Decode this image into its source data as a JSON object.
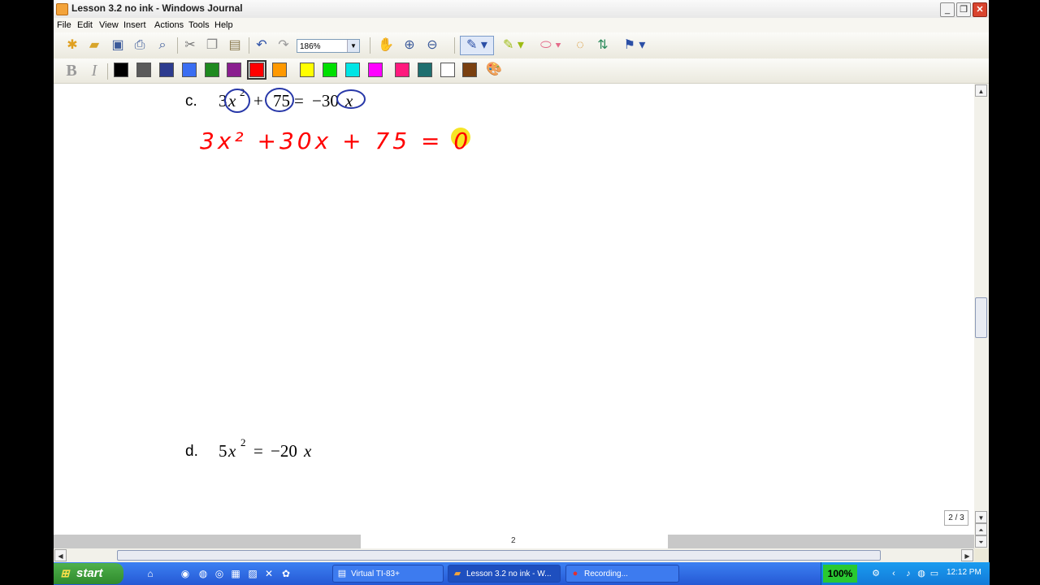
{
  "window": {
    "title": "Lesson 3.2 no ink - Windows Journal",
    "controls": [
      "_",
      "❐",
      "✕"
    ]
  },
  "menu": [
    "File",
    "Edit",
    "View",
    "Insert",
    "Actions",
    "Tools",
    "Help"
  ],
  "toolbar": {
    "zoom_value": "186%",
    "icons": [
      "new-note-icon",
      "open-icon",
      "save-icon",
      "print-icon",
      "find-icon",
      "cut-icon",
      "copy-icon",
      "paste-icon",
      "undo-icon",
      "redo-icon",
      "hand-pan-icon",
      "zoom-in-icon",
      "zoom-out-icon",
      "pen-icon",
      "highlighter-icon",
      "eraser-icon",
      "lasso-select-icon",
      "insert-space-icon",
      "flag-icon"
    ]
  },
  "format_bar": {
    "bold": "B",
    "italic": "I",
    "colors": [
      "#000000",
      "#5a5a5a",
      "#2d3c8f",
      "#3a6ef2",
      "#1f8a1f",
      "#8a1f8f",
      "#ff0000",
      "#ff9900",
      "#ffff00",
      "#00e000",
      "#00e5e5",
      "#ff00ff",
      "#ff1a7d",
      "#1f6f6f",
      "#ffffff",
      "#7a4010"
    ],
    "selected_color": "#ff0000"
  },
  "document": {
    "problem_c": {
      "label": "c.",
      "a": "3",
      "var": "x",
      "exp": "2",
      "plus": "+",
      "b": "75",
      "eq": "=",
      "rhs": "−30",
      "rhs_var": "x"
    },
    "ink_line": {
      "text": "3x² +30x + 75 = 0",
      "color": "#ff0000"
    },
    "problem_d": {
      "label": "d.",
      "a": "5",
      "var": "x",
      "exp": "2",
      "eq": "=",
      "rhs": "−20",
      "rhs_var": "x"
    },
    "page_number": "2",
    "page_indicator": "2 / 3"
  },
  "taskbar": {
    "start": "start",
    "tasks": [
      {
        "label": "Virtual TI-83+",
        "icon": "calculator-icon"
      },
      {
        "label": "Lesson 3.2 no ink - W...",
        "icon": "journal-icon"
      },
      {
        "label": "Recording...",
        "icon": "recording-icon"
      }
    ],
    "tray_percent": "100%",
    "clock": "12:12 PM"
  }
}
